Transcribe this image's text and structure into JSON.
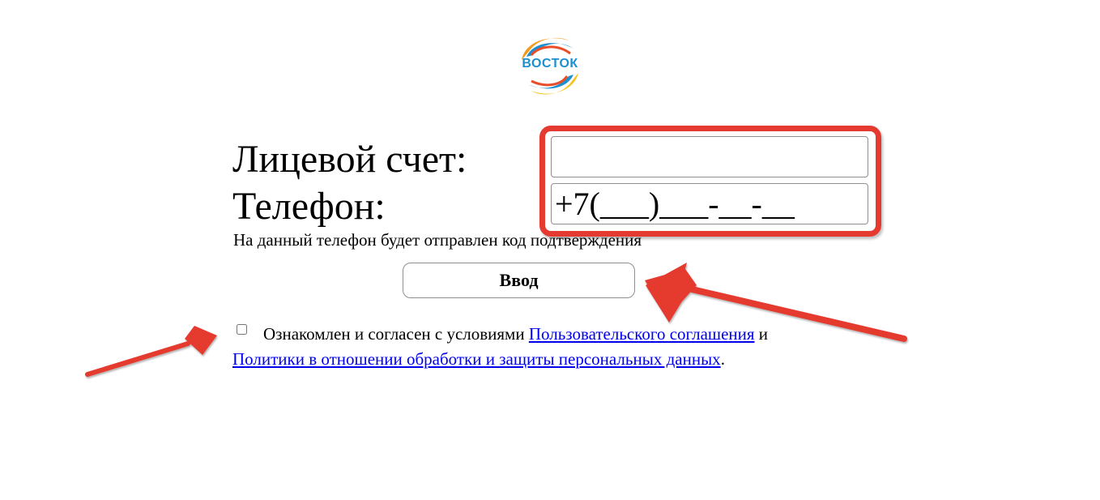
{
  "logo": {
    "text": "ВОСТОК",
    "colors": {
      "orange": "#f39a1e",
      "blue": "#1d8fd0",
      "red": "#e94e2a",
      "yellow": "#f7c21b"
    }
  },
  "form": {
    "account_label": "Лицевой счет:",
    "account_value": "",
    "phone_label": "Телефон:",
    "phone_placeholder": "+7(___)___-__-__",
    "hint": "На данный телефон будет отправлен код подтверждения",
    "submit_label": "Ввод"
  },
  "agreement": {
    "checked": false,
    "text_before": "Ознакомлен и согласен с условиями ",
    "link_terms": "Пользовательского соглашения",
    "text_and": " и",
    "link_privacy": "Политики в отношении обработки и защиты персональных данных",
    "text_end": "."
  },
  "annotations": {
    "highlight_color": "#e53a2f"
  }
}
